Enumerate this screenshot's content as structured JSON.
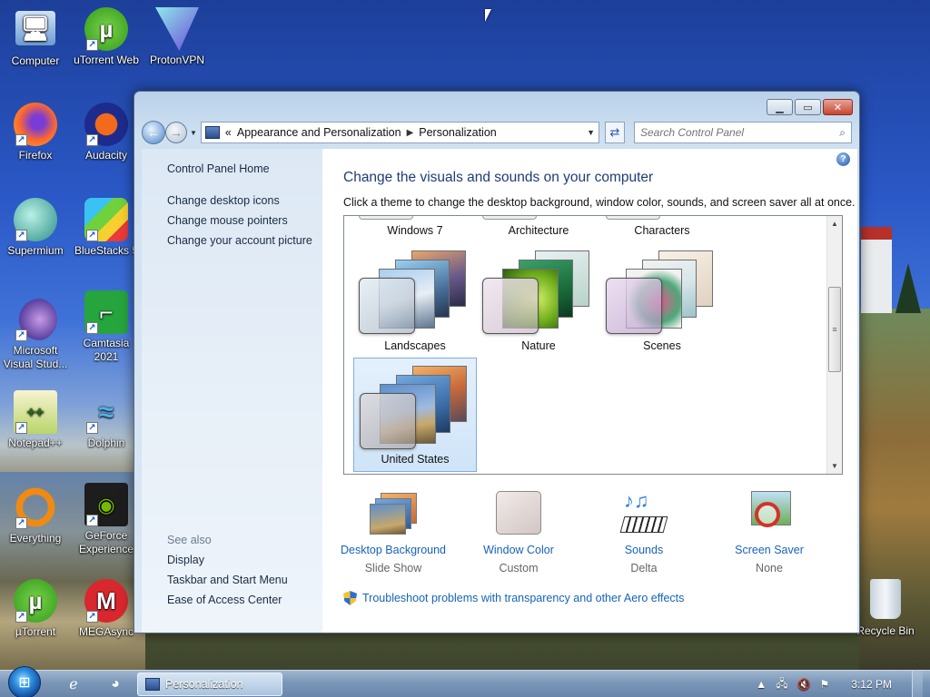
{
  "desktop": {
    "icons": [
      {
        "label": "Computer",
        "icon": "computer-icon"
      },
      {
        "label": "uTorrent Web",
        "icon": "utorrent-web-icon"
      },
      {
        "label": "ProtonVPN",
        "icon": "protonvpn-icon"
      },
      {
        "label": "Firefox",
        "icon": "firefox-icon"
      },
      {
        "label": "Audacity",
        "icon": "audacity-icon"
      },
      {
        "label": "Supermium",
        "icon": "supermium-icon"
      },
      {
        "label": "BlueStacks 5",
        "icon": "bluestacks-icon"
      },
      {
        "label": "Microsoft Visual Stud...",
        "icon": "visual-studio-icon"
      },
      {
        "label": "Camtasia 2021",
        "icon": "camtasia-icon"
      },
      {
        "label": "Notepad++",
        "icon": "notepadpp-icon"
      },
      {
        "label": "Dolphin",
        "icon": "dolphin-icon"
      },
      {
        "label": "Everything",
        "icon": "everything-icon"
      },
      {
        "label": "GeForce Experience",
        "icon": "geforce-icon"
      },
      {
        "label": "µTorrent",
        "icon": "utorrent-icon"
      },
      {
        "label": "MEGAsync",
        "icon": "megasync-icon"
      },
      {
        "label": "Recycle Bin",
        "icon": "recycle-bin-icon"
      }
    ]
  },
  "window": {
    "address": {
      "overflow": "«",
      "crumbs": [
        "Appearance and Personalization",
        "Personalization"
      ]
    },
    "search_placeholder": "Search Control Panel",
    "left_pane": {
      "home": "Control Panel Home",
      "tasks": [
        "Change desktop icons",
        "Change mouse pointers",
        "Change your account picture"
      ],
      "see_also_header": "See also",
      "see_also": [
        "Display",
        "Taskbar and Start Menu",
        "Ease of Access Center"
      ]
    },
    "title": "Change the visuals and sounds on your computer",
    "subtitle": "Click a theme to change the desktop background, window color, sounds, and screen saver all at once.",
    "themes": {
      "partial_row": [
        "Windows 7",
        "Architecture",
        "Characters"
      ],
      "row1": [
        "Landscapes",
        "Nature",
        "Scenes"
      ],
      "row2": [
        "United States"
      ],
      "selected": "United States"
    },
    "settings": [
      {
        "name": "Desktop Background",
        "value": "Slide Show",
        "icon": "desktop-background-icon"
      },
      {
        "name": "Window Color",
        "value": "Custom",
        "icon": "window-color-icon"
      },
      {
        "name": "Sounds",
        "value": "Delta",
        "icon": "sounds-icon"
      },
      {
        "name": "Screen Saver",
        "value": "None",
        "icon": "screen-saver-icon"
      }
    ],
    "troubleshoot": "Troubleshoot problems with transparency and other Aero effects"
  },
  "taskbar": {
    "task_label": "Personalization",
    "clock": "3:12 PM"
  },
  "colors": {
    "link": "#1663b8",
    "title": "#1e3d75"
  }
}
